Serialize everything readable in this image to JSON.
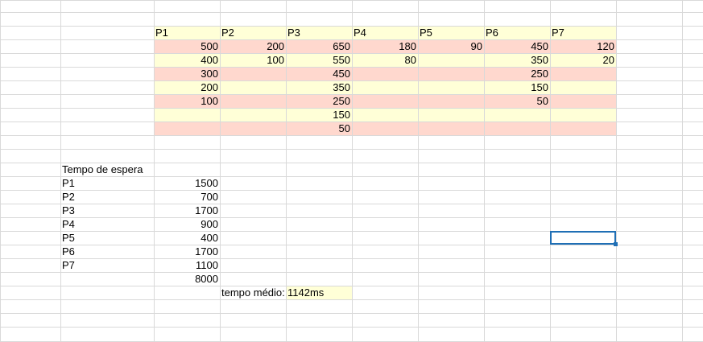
{
  "sheet": {
    "colors": {
      "grid": "#d9d9d9",
      "band_a": "#ffffd7",
      "band_b": "#ffd8ce",
      "selection": "#1f6fb5"
    },
    "process_headers": [
      "P1",
      "P2",
      "P3",
      "P4",
      "P5",
      "P6",
      "P7"
    ],
    "burst_rows": [
      [
        "500",
        "200",
        "650",
        "180",
        "90",
        "450",
        "120"
      ],
      [
        "400",
        "100",
        "550",
        "80",
        "",
        "350",
        "20"
      ],
      [
        "300",
        "",
        "450",
        "",
        "",
        "250",
        ""
      ],
      [
        "200",
        "",
        "350",
        "",
        "",
        "150",
        ""
      ],
      [
        "100",
        "",
        "250",
        "",
        "",
        "50",
        ""
      ],
      [
        "",
        "",
        "150",
        "",
        "",
        "",
        ""
      ],
      [
        "",
        "",
        "50",
        "",
        "",
        "",
        ""
      ]
    ],
    "wait_title": "Tempo de espera",
    "wait_rows": [
      {
        "label": "P1",
        "value": "1500"
      },
      {
        "label": "P2",
        "value": "700"
      },
      {
        "label": "P3",
        "value": "1700"
      },
      {
        "label": "P4",
        "value": "900"
      },
      {
        "label": "P5",
        "value": "400"
      },
      {
        "label": "P6",
        "value": "1700"
      },
      {
        "label": "P7",
        "value": "1100"
      }
    ],
    "wait_total": "8000",
    "avg_label": "tempo médio:",
    "avg_value": "1142ms"
  }
}
